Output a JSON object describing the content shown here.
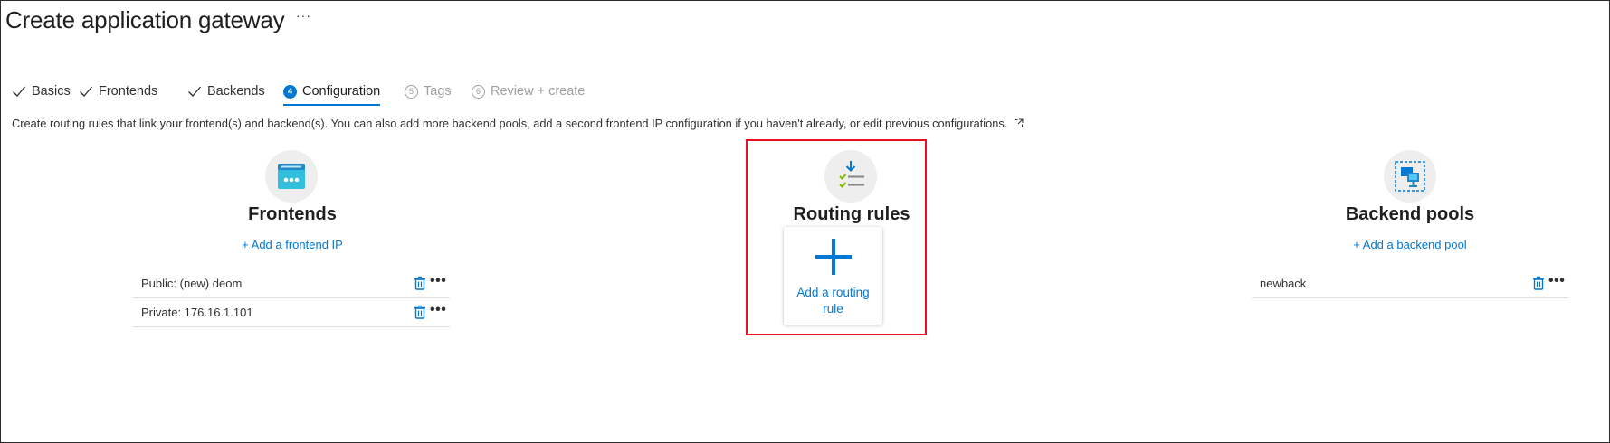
{
  "page": {
    "title": "Create application gateway",
    "more": "···"
  },
  "tabs": [
    {
      "label": "Basics",
      "state": "completed"
    },
    {
      "label": "Frontends",
      "state": "completed"
    },
    {
      "label": "Backends",
      "state": "completed"
    },
    {
      "label": "Configuration",
      "state": "active",
      "step": "4"
    },
    {
      "label": "Tags",
      "state": "disabled",
      "step": "5"
    },
    {
      "label": "Review + create",
      "state": "disabled",
      "step": "6"
    }
  ],
  "description": "Create routing rules that link your frontend(s) and backend(s). You can also add more backend pools, add a second frontend IP configuration if you haven't already, or edit previous configurations.",
  "frontends": {
    "heading": "Frontends",
    "add_link": "+ Add a frontend IP",
    "items": [
      {
        "label": "Public: (new) deom"
      },
      {
        "label": "Private: 176.16.1.101"
      }
    ],
    "more": "•••"
  },
  "routing_rules": {
    "heading": "Routing rules",
    "add_card_label": "Add a routing rule"
  },
  "backend_pools": {
    "heading": "Backend pools",
    "add_link": "+ Add a backend pool",
    "items": [
      {
        "label": "newback"
      }
    ],
    "more": "•••"
  },
  "colors": {
    "accent": "#0078d4",
    "highlight": "#e81123",
    "text": "#323130"
  },
  "icons": {
    "completed_tab": "checkmark-icon",
    "external": "external-link-icon",
    "frontends": "frontend-ip-icon",
    "routing_rules": "routing-rules-icon",
    "backend_pools": "backend-pool-icon",
    "delete": "trash-icon",
    "more": "more-options-icon",
    "add": "plus-icon"
  }
}
